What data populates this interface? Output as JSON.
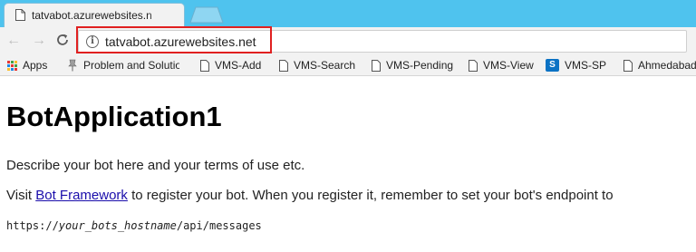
{
  "tab": {
    "title": "tatvabot.azurewebsites.n",
    "favicon": "page-icon"
  },
  "toolbar": {
    "back_icon": "←",
    "forward_icon": "→",
    "reload_icon": "C",
    "info_icon": "i",
    "url": "tatvabot.azurewebsites.net",
    "highlight_color": "#e02020"
  },
  "bookmarks": [
    {
      "label": "Apps",
      "icon": "apps-grid-icon"
    },
    {
      "label": "Problem and Solution",
      "icon": "pin-icon"
    },
    {
      "label": "VMS-Add",
      "icon": "page-icon"
    },
    {
      "label": "VMS-Search",
      "icon": "page-icon"
    },
    {
      "label": "VMS-Pending",
      "icon": "page-icon"
    },
    {
      "label": "VMS-View",
      "icon": "page-icon"
    },
    {
      "label": "VMS-SP",
      "icon": "sharepoint-icon"
    },
    {
      "label": "Ahmedabad",
      "icon": "page-icon"
    }
  ],
  "page": {
    "heading": "BotApplication1",
    "description": "Describe your bot here and your terms of use etc.",
    "visit_prefix": "Visit ",
    "link_text": "Bot Framework",
    "visit_suffix": " to register your bot. When you register it, remember to set your bot's endpoint to",
    "code_prefix": "https://",
    "code_italic": "your_bots_hostname",
    "code_suffix": "/api/messages"
  },
  "colors": {
    "tabstrip": "#4fc3ee",
    "link": "#1a0dab",
    "sharepoint": "#0b72c4"
  }
}
